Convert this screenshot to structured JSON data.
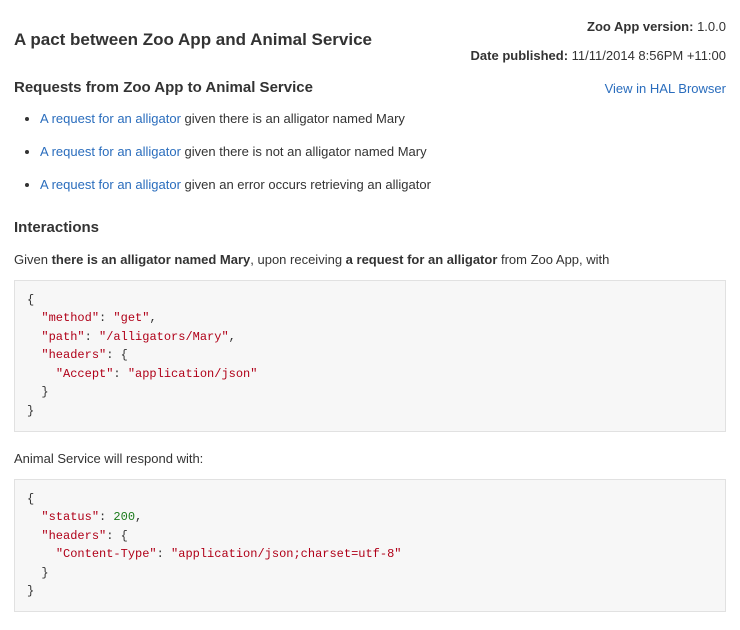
{
  "meta": {
    "version_label": "Zoo App version:",
    "version_value": "1.0.0",
    "date_label": "Date published:",
    "date_value": "11/11/2014 8:56PM +11:00",
    "hal_link": "View in HAL Browser"
  },
  "title": "A pact between Zoo App and Animal Service",
  "requests_heading": "Requests from Zoo App to Animal Service",
  "requests": [
    {
      "link": "A request for an alligator",
      "rest": " given there is an alligator named Mary"
    },
    {
      "link": "A request for an alligator",
      "rest": " given there is not an alligator named Mary"
    },
    {
      "link": "A request for an alligator",
      "rest": " given an error occurs retrieving an alligator"
    }
  ],
  "interactions_heading": "Interactions",
  "interaction_line": {
    "given_prefix": "Given ",
    "given_state": "there is an alligator named Mary",
    "upon": ", upon receiving ",
    "request_name": "a request for an alligator",
    "from_suffix": " from Zoo App, with"
  },
  "request_json": {
    "method": "get",
    "path": "/alligators/Mary",
    "headers": {
      "Accept": "application/json"
    }
  },
  "respond_line": "Animal Service will respond with:",
  "response_json": {
    "status": 200,
    "headers": {
      "Content-Type": "application/json;charset=utf-8"
    }
  }
}
